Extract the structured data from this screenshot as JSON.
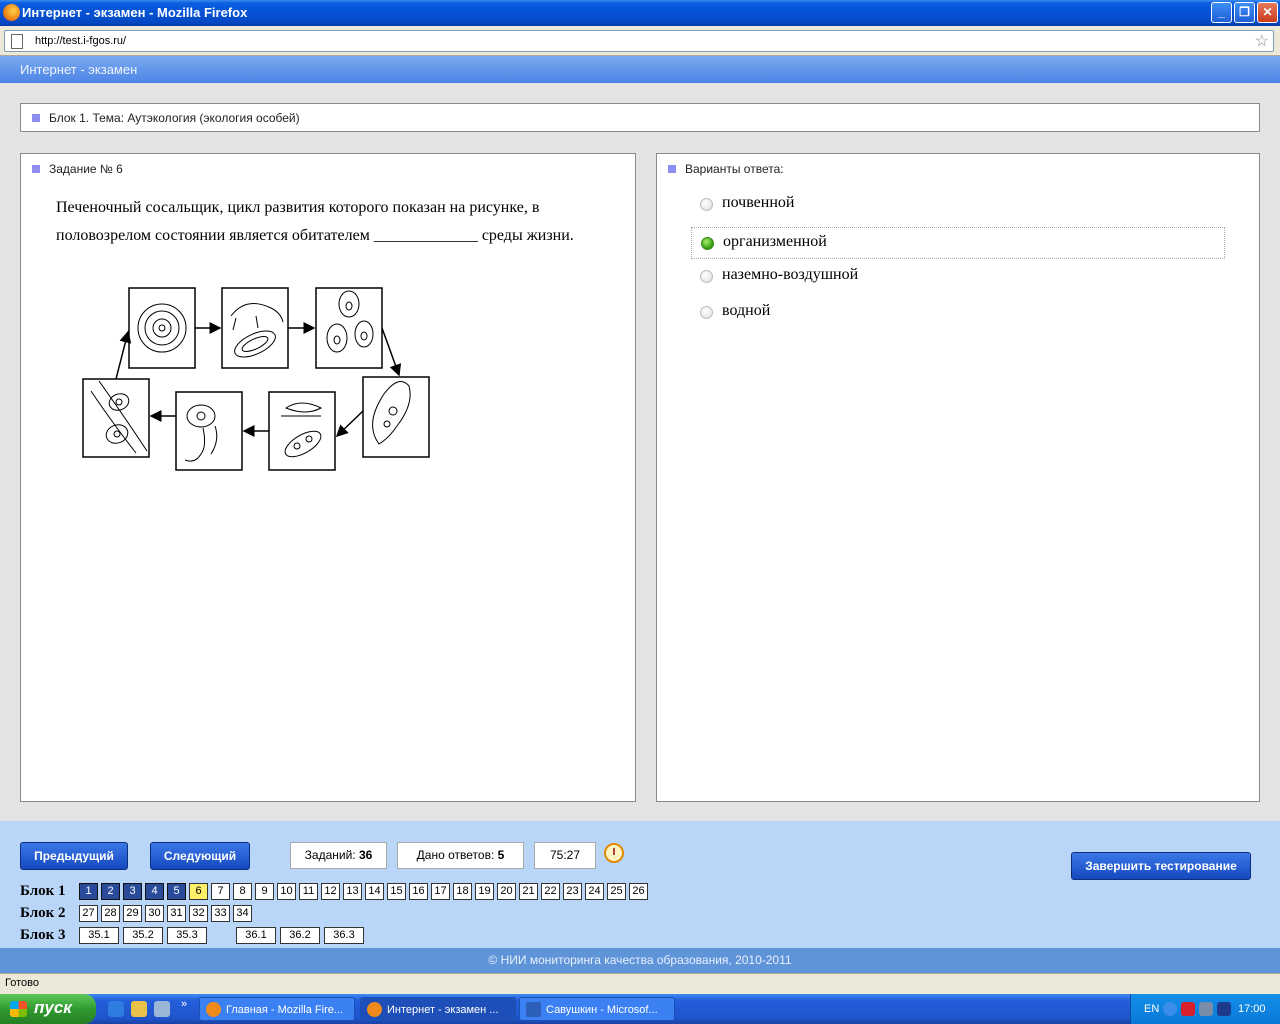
{
  "window": {
    "title": "Интернет - экзамен - Mozilla Firefox"
  },
  "browser": {
    "url": "http://test.i-fgos.ru/"
  },
  "app": {
    "header": "Интернет - экзамен"
  },
  "block_header": {
    "text": "Блок 1. Тема: Аутэкология (экология особей)"
  },
  "task": {
    "label": "Задание № 6",
    "question": "Печеночный сосальщик, цикл развития которого показан на рисунке, в половозрелом состоянии является обитателем _____________ среды жизни."
  },
  "answers": {
    "label": "Варианты ответа:",
    "options": [
      {
        "text": "почвенной",
        "selected": false
      },
      {
        "text": "организменной",
        "selected": true
      },
      {
        "text": "наземно-воздушной",
        "selected": false
      },
      {
        "text": "водной",
        "selected": false
      }
    ]
  },
  "controls": {
    "prev": "Предыдущий",
    "next": "Следующий",
    "tasks_label": "Заданий:",
    "tasks_count": "36",
    "answered_label": "Дано ответов:",
    "answered_count": "5",
    "timer": "75:27",
    "finish": "Завершить тестирование"
  },
  "blocks": [
    {
      "label": "Блок 1",
      "items": [
        "1",
        "2",
        "3",
        "4",
        "5",
        "6",
        "7",
        "8",
        "9",
        "10",
        "11",
        "12",
        "13",
        "14",
        "15",
        "16",
        "17",
        "18",
        "19",
        "20",
        "21",
        "22",
        "23",
        "24",
        "25",
        "26"
      ],
      "answered": [
        "1",
        "2",
        "3",
        "4",
        "5"
      ],
      "current": "6"
    },
    {
      "label": "Блок 2",
      "items": [
        "27",
        "28",
        "29",
        "30",
        "31",
        "32",
        "33",
        "34"
      ],
      "answered": [],
      "current": ""
    },
    {
      "label": "Блок 3",
      "items": [
        "35.1",
        "35.2",
        "35.3",
        "36.1",
        "36.2",
        "36.3"
      ],
      "answered": [],
      "current": ""
    }
  ],
  "footer": "© НИИ мониторинга качества образования, 2010-2011",
  "status": "Готово",
  "taskbar": {
    "start": "пуск",
    "tasks": [
      "Главная - Mozilla Fire...",
      "Интернет - экзамен ...",
      "Савушкин - Microsof..."
    ],
    "lang": "EN",
    "time": "17:00"
  },
  "colors": {
    "answered": "#2a4a9a",
    "current": "#fff06a",
    "selected_radio": "#3fa416"
  }
}
